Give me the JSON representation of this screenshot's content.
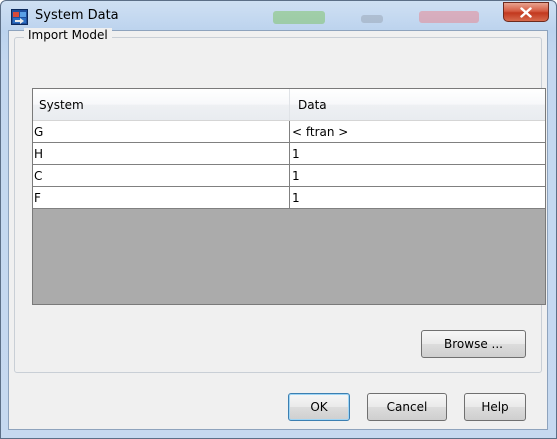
{
  "window": {
    "title": "System Data"
  },
  "group": {
    "label": "Import Model"
  },
  "table": {
    "columns": [
      "System",
      "Data"
    ],
    "rows": [
      {
        "system": "G",
        "data": "< ftran >"
      },
      {
        "system": "H",
        "data": "1"
      },
      {
        "system": "C",
        "data": "1"
      },
      {
        "system": "F",
        "data": "1"
      }
    ]
  },
  "buttons": {
    "browse": "Browse ...",
    "ok": "OK",
    "cancel": "Cancel",
    "help": "Help"
  },
  "icons": {
    "app": "system-data-app-icon",
    "close": "close-icon"
  },
  "colors": {
    "titlebar": "#bcd3ee",
    "close_button": "#c2381e",
    "client_bg": "#f0f0f0",
    "table_empty_bg": "#ababab"
  }
}
